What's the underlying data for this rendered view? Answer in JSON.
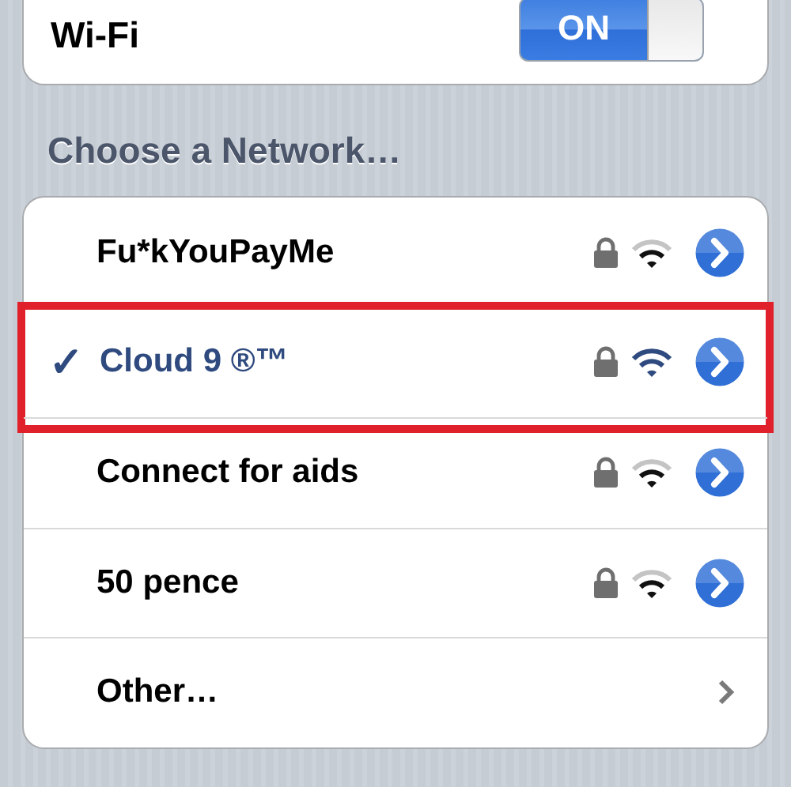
{
  "wifi": {
    "label": "Wi-Fi",
    "on": true,
    "switch_text": "ON"
  },
  "section_title": "Choose a Network…",
  "networks": [
    {
      "kind": "network",
      "name": "Fu*kYouPayMe",
      "selected": false,
      "locked": true,
      "highlighted": false
    },
    {
      "kind": "network",
      "name": "Cloud 9 ®™",
      "check": "✓",
      "selected": true,
      "locked": true,
      "highlighted": true
    },
    {
      "kind": "network",
      "name": "Connect for aids",
      "selected": false,
      "locked": true,
      "highlighted": false
    },
    {
      "kind": "network",
      "name": "50 pence",
      "selected": false,
      "locked": true,
      "highlighted": false
    },
    {
      "kind": "other",
      "name": "Other…"
    }
  ]
}
